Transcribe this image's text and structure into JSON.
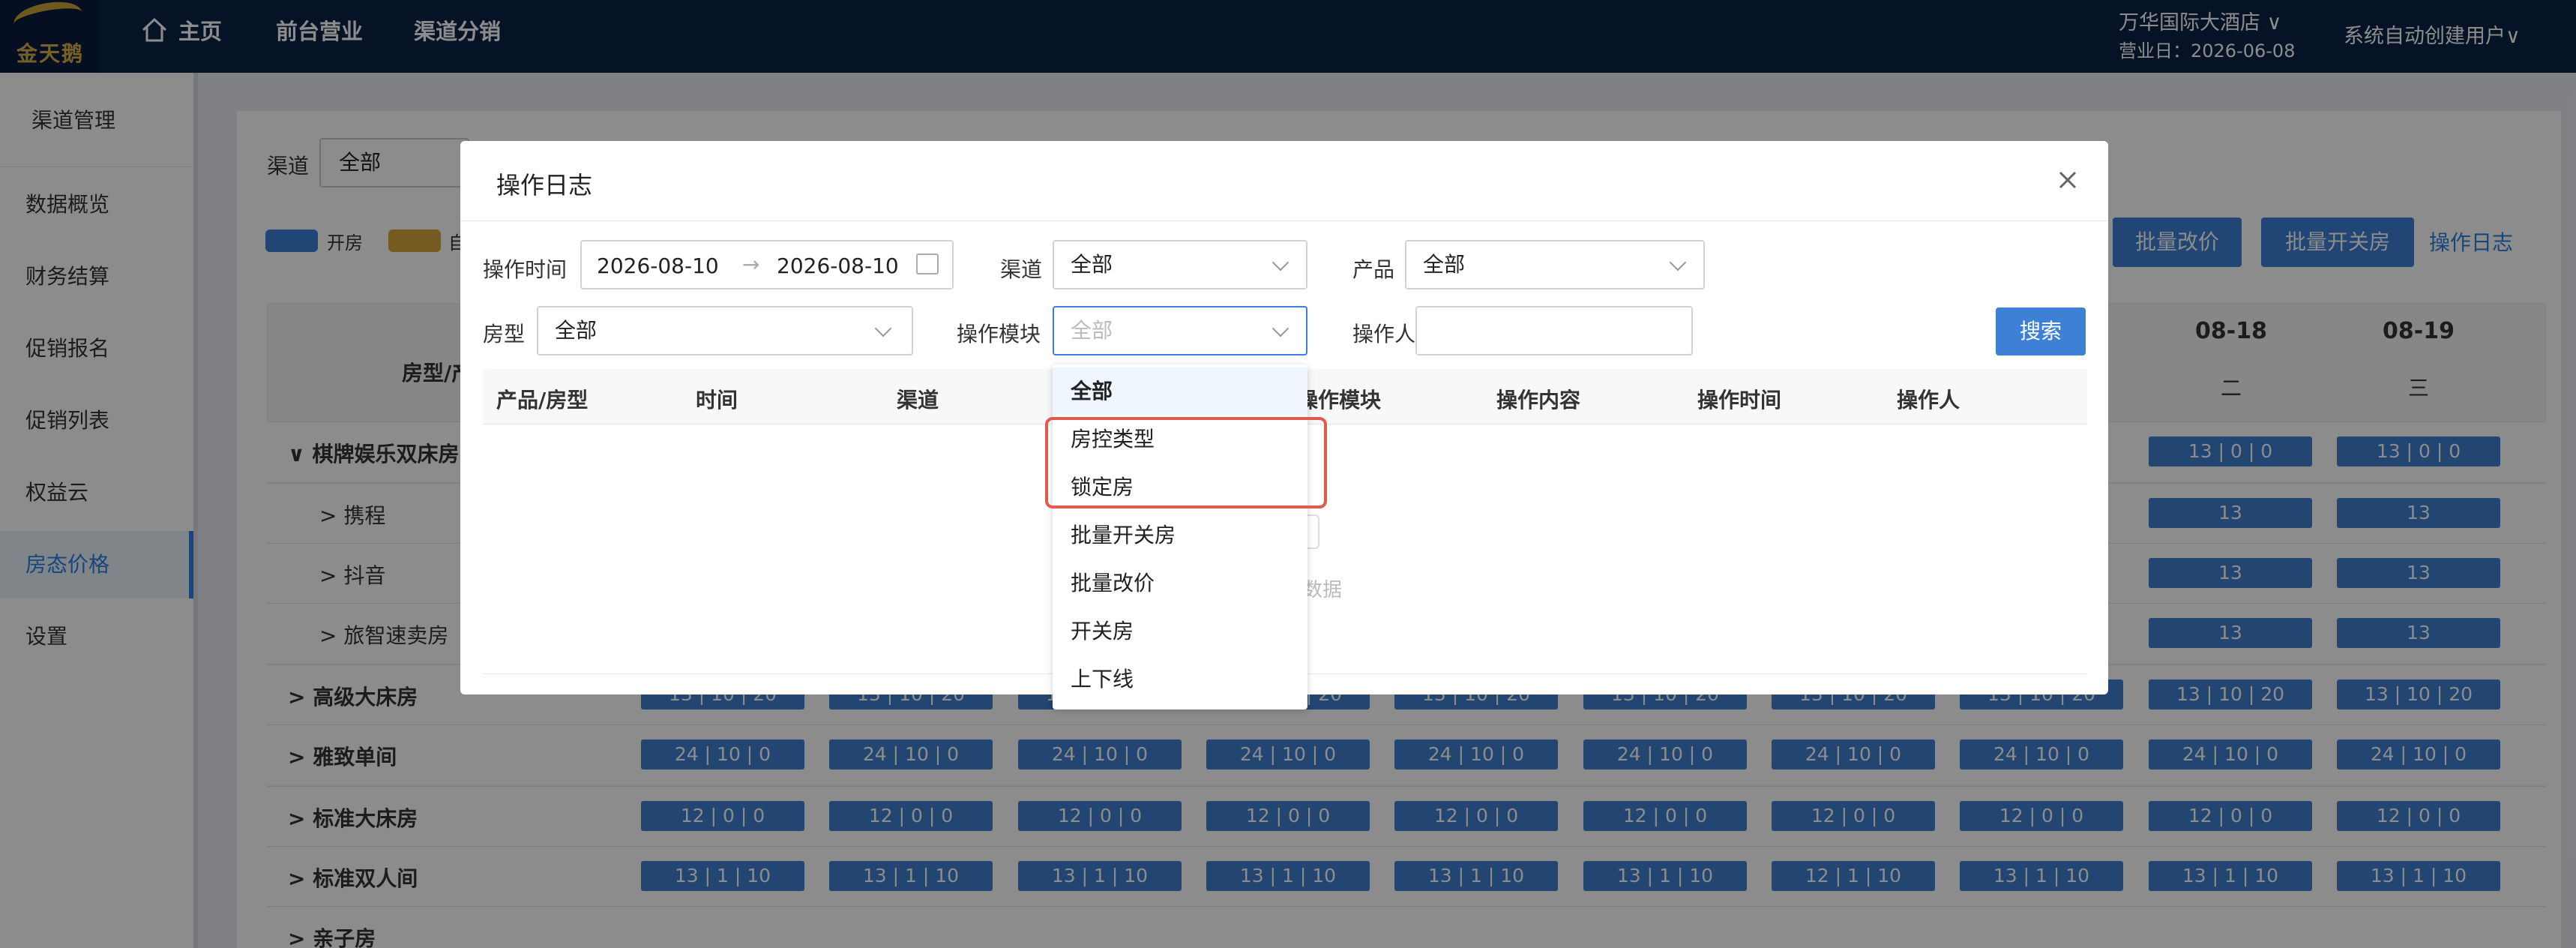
{
  "topbar": {
    "logo_text": "金天鹅",
    "nav": [
      "主页",
      "前台营业",
      "渠道分销"
    ],
    "hotel": "万华国际大酒店",
    "business_date": "营业日：2026-06-08",
    "user": "系统自动创建用户"
  },
  "sidebar": {
    "title": "渠道管理",
    "items": [
      "数据概览",
      "财务结算",
      "促销报名",
      "促销列表",
      "权益云",
      "房态价格",
      "设置"
    ],
    "active": "房态价格"
  },
  "main": {
    "channel_label": "渠道",
    "channel_value": "全部",
    "legend": [
      {
        "label": "开房",
        "color": "#3d80d6"
      },
      {
        "label": "自",
        "color": "#d8a53a"
      }
    ],
    "buttons": [
      "批量改价",
      "批量开关房"
    ],
    "log_link": "操作日志",
    "grid_header": "房型/产",
    "dates": [
      {
        "date": "08-18",
        "weekday": "二"
      },
      {
        "date": "08-19",
        "weekday": "三"
      }
    ],
    "rows": [
      {
        "label": "棋牌娱乐双床房",
        "type": "group",
        "cells": [
          "13 | 0 | 0",
          "13 | 0 | 0"
        ]
      },
      {
        "label": "携程",
        "type": "sub",
        "cells": [
          "13",
          "13"
        ]
      },
      {
        "label": "抖音",
        "type": "sub",
        "cells": [
          "13",
          "13"
        ]
      },
      {
        "label": "旅智速卖房",
        "type": "sub",
        "cells": [
          "13",
          "13"
        ]
      },
      {
        "label": "高级大床房",
        "type": "group",
        "cells": [
          "13 | 10 | 20",
          "13 | 10 | 20",
          "13 | 10 | 20",
          "13 | 10 | 20",
          "13 | 10 | 20",
          "13 | 10 | 20",
          "13 | 10 | 20",
          "13 | 10 | 20",
          "13 | 10 | 20",
          "13 | 10 | 20"
        ]
      },
      {
        "label": "雅致单间",
        "type": "group",
        "cells": [
          "24 | 10 | 0",
          "24 | 10 | 0",
          "24 | 10 | 0",
          "24 | 10 | 0",
          "24 | 10 | 0",
          "24 | 10 | 0",
          "24 | 10 | 0",
          "24 | 10 | 0",
          "24 | 10 | 0",
          "24 | 10 | 0"
        ]
      },
      {
        "label": "标准大床房",
        "type": "group",
        "cells": [
          "12 | 0 | 0",
          "12 | 0 | 0",
          "12 | 0 | 0",
          "12 | 0 | 0",
          "12 | 0 | 0",
          "12 | 0 | 0",
          "12 | 0 | 0",
          "12 | 0 | 0",
          "12 | 0 | 0",
          "12 | 0 | 0"
        ]
      },
      {
        "label": "标准双人间",
        "type": "group",
        "cells": [
          "13 | 1 | 10",
          "13 | 1 | 10",
          "13 | 1 | 10",
          "13 | 1 | 10",
          "13 | 1 | 10",
          "13 | 1 | 10",
          "12 | 1 | 10",
          "13 | 1 | 10",
          "13 | 1 | 10",
          "13 | 1 | 10"
        ]
      },
      {
        "label": "亲子房",
        "type": "group",
        "cells": []
      }
    ]
  },
  "modal": {
    "title": "操作日志",
    "filters": {
      "time_label": "操作时间",
      "date_start": "2026-08-10",
      "date_end": "2026-08-10",
      "channel_label": "渠道",
      "channel_value": "全部",
      "product_label": "产品",
      "product_value": "全部",
      "roomtype_label": "房型",
      "roomtype_value": "全部",
      "module_label": "操作模块",
      "module_placeholder": "全部",
      "operator_label": "操作人",
      "operator_value": ""
    },
    "search_button": "搜索",
    "columns": [
      "产品/房型",
      "时间",
      "渠道",
      "操作模块",
      "操作内容",
      "操作时间",
      "操作人"
    ],
    "empty_text": "数据",
    "dropdown": {
      "options": [
        "全部",
        "房控类型",
        "锁定房",
        "批量开关房",
        "批量改价",
        "开关房",
        "上下线"
      ],
      "selected": "全部",
      "highlighted": [
        "房控类型",
        "锁定房"
      ]
    }
  }
}
